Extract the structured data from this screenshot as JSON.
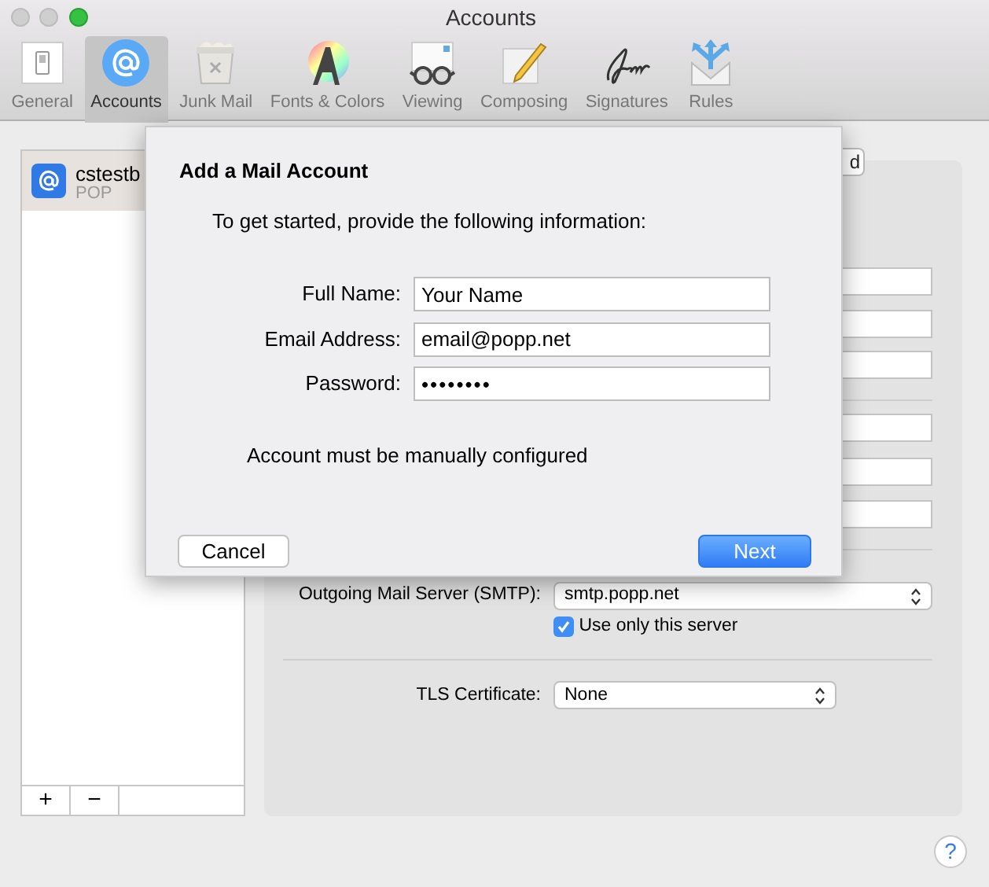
{
  "window": {
    "title": "Accounts"
  },
  "toolbar": [
    {
      "label": "General",
      "selected": false
    },
    {
      "label": "Accounts",
      "selected": true
    },
    {
      "label": "Junk Mail",
      "selected": false
    },
    {
      "label": "Fonts & Colors",
      "selected": false
    },
    {
      "label": "Viewing",
      "selected": false
    },
    {
      "label": "Composing",
      "selected": false
    },
    {
      "label": "Signatures",
      "selected": false
    },
    {
      "label": "Rules",
      "selected": false
    }
  ],
  "accounts": [
    {
      "name": "cstestb",
      "type": "POP",
      "selected": true
    }
  ],
  "list_buttons": [
    "+",
    "−"
  ],
  "account_panel": {
    "button": "d",
    "smtp_label": "Outgoing Mail Server (SMTP):",
    "smtp_value": "smtp.popp.net",
    "use_only_label": "Use only this server",
    "use_only_checked": true,
    "tls_label": "TLS Certificate:",
    "tls_value": "None"
  },
  "help": "?",
  "dialog": {
    "title": "Add a Mail Account",
    "intro": "To get started, provide the following information:",
    "fields": [
      {
        "label": "Full Name:",
        "value": "Your Name"
      },
      {
        "label": "Email Address:",
        "value": "email@popp.net"
      },
      {
        "label": "Password:",
        "value": "••••••••"
      }
    ],
    "note": "Account must be manually configured",
    "cancel": "Cancel",
    "next": "Next"
  }
}
